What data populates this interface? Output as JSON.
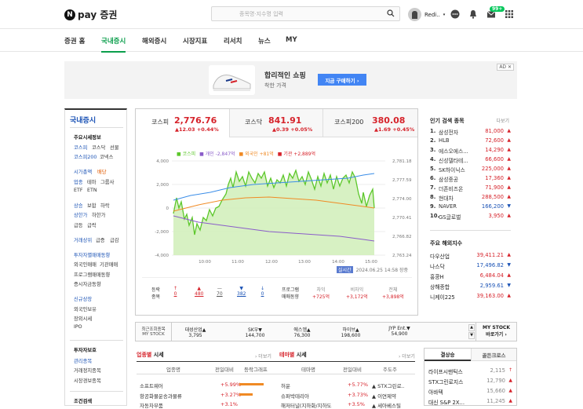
{
  "header": {
    "brand": "pay 증권",
    "logo_letter": "N",
    "search_placeholder": "종목명·지수명 입력",
    "user": "Redi..",
    "badge": "99+"
  },
  "nav": [
    "증권 홈",
    "국내증시",
    "해외증시",
    "시장지표",
    "리서치",
    "뉴스",
    "MY"
  ],
  "ad": {
    "title": "합리적인 쇼핑",
    "subtitle": "착한 가격",
    "button": "지금 구매하기 ›",
    "tag": "AD ✕"
  },
  "sidebar": {
    "title": "국내증시",
    "items": [
      "주요시세정보",
      "코스피",
      "코스닥",
      "선물",
      "코스피200",
      "코넥스",
      "시가총액",
      "배당",
      "업종",
      "테마",
      "그룹사",
      "ETF",
      "ETN",
      "상승",
      "보합",
      "하락",
      "상한가",
      "하한가",
      "급등",
      "급락",
      "거래상위",
      "급증",
      "급감",
      "투자자별매매동향",
      "외국인매매",
      "기관매매",
      "프로그램매매동향",
      "증시자금동향",
      "신규상장",
      "외국인보유",
      "장외시세",
      "IPO",
      "투자자보호",
      "관리종목",
      "거래정지종목",
      "시장경보종목",
      "조건검색"
    ]
  },
  "indices": [
    {
      "name": "코스피",
      "value": "2,776.76",
      "change": "▲12.03 +0.44%"
    },
    {
      "name": "코스닥",
      "value": "841.91",
      "change": "▲0.39 +0.05%"
    },
    {
      "name": "코스피200",
      "value": "380.08",
      "change": "▲1.69 +0.45%"
    }
  ],
  "chart_legend": [
    "■ 코스피",
    "■ 개인 -2,847억",
    "■ 외국인 +81억",
    "■ 기관 +2,889억"
  ],
  "chart_data": {
    "type": "line",
    "x": [
      "10:00",
      "11:00",
      "12:00",
      "13:00",
      "14:00",
      "15:00"
    ],
    "y_left_ticks": [
      "4,000",
      "2,000",
      "0",
      "-2,000",
      "-4,000"
    ],
    "y_right_ticks": [
      "2,781.18",
      "2,777.59",
      "2,774.00",
      "2,770.41",
      "2,766.82",
      "2,763.24"
    ],
    "series": [
      {
        "name": "코스피",
        "color": "#5cc72a"
      },
      {
        "name": "개인",
        "color": "#8a5cc9"
      },
      {
        "name": "외국인",
        "color": "#f08a24"
      },
      {
        "name": "기관",
        "color": "#3a8de8"
      }
    ]
  },
  "chart_meta": {
    "badge": "실시간",
    "timestamp": "2024.06.25 14:58 장중"
  },
  "stats": {
    "labels": [
      "등락\n종목",
      "상승",
      "보합",
      "하락",
      "하한"
    ],
    "up_limit": "0",
    "up": "480",
    "flat": "70",
    "down": "382",
    "down_limit": "0",
    "program_label": "프로그램\n매매동향",
    "diff_label": "차익",
    "diff": "+725억",
    "nondiff_label": "비차익",
    "nondiff": "+3,172억",
    "total_label": "전체",
    "total": "+3,898억"
  },
  "popular": {
    "title": "인기 검색 종목",
    "more": "다보기",
    "items": [
      [
        "1.",
        "삼성전자",
        "81,000",
        "up"
      ],
      [
        "2.",
        "HLB",
        "72,600",
        "up"
      ],
      [
        "3.",
        "에스오에스...",
        "14,290",
        "up"
      ],
      [
        "4.",
        "신성델타테...",
        "66,600",
        "up"
      ],
      [
        "5.",
        "SK하이닉스",
        "225,000",
        "up"
      ],
      [
        "6.",
        "삼성중공",
        "17,360",
        "up"
      ],
      [
        "7.",
        "더존비즈온",
        "71,900",
        "up"
      ],
      [
        "8.",
        "현대차",
        "288,500",
        "up"
      ],
      [
        "9.",
        "NAVER",
        "166,200",
        "down"
      ],
      [
        "10.",
        "GS글로벌",
        "3,950",
        "up"
      ]
    ]
  },
  "global": {
    "title": "주요 해외지수",
    "items": [
      [
        "다우산업",
        "39,411.21",
        "up"
      ],
      [
        "나스닥",
        "17,496.82",
        "down"
      ],
      [
        "홍콩H",
        "6,484.04",
        "up"
      ],
      [
        "상해종합",
        "2,959.61",
        "down"
      ],
      [
        "니케이225",
        "39,163.00",
        "up"
      ]
    ]
  },
  "ticker": {
    "label": "최근조회종목\nMY STOCK",
    "items": [
      [
        "대성산업▲",
        "3,795"
      ],
      [
        "SK우▼",
        "144,700"
      ],
      [
        "에스엠▲",
        "76,300"
      ],
      [
        "하이브▲",
        "198,600"
      ],
      [
        "JYP Ent.▼",
        "54,900"
      ]
    ],
    "mystock": "MY STOCK\n바로가기 ›"
  },
  "sections": {
    "upjong": "업종별 시세",
    "tema": "테마별 시세",
    "more": "› 더보기",
    "cols_upjong": [
      "업종명",
      "전일대비",
      "등락그래프"
    ],
    "cols_tema": [
      "테마명",
      "전일대비",
      "주도주"
    ],
    "upjong_rows": [
      [
        "소프트웨어",
        "+5.99%"
      ],
      [
        "항공화물운송과물류",
        "+3.27%"
      ],
      [
        "자동차부품",
        "+3.1%"
      ]
    ],
    "tema_rows": [
      [
        "허운",
        "+5.77%",
        "▲ STX그린로.."
      ],
      [
        "슈퍼박테리아",
        "+3.73%",
        "▲ 이연제약"
      ],
      [
        "해저터널(지하화/지하도",
        "+3.5%",
        "▲ 세아베스틸"
      ]
    ]
  },
  "right_tabs": {
    "tab1": "결상승",
    "tab2": "골든크로스",
    "items": [
      [
        "라이프시맨틱스",
        "2,115"
      ],
      [
        "STX그린로지스",
        "12,790"
      ],
      [
        "아바텍",
        "15,660"
      ],
      [
        "대신 S&P 2X...",
        "11,245"
      ]
    ]
  }
}
